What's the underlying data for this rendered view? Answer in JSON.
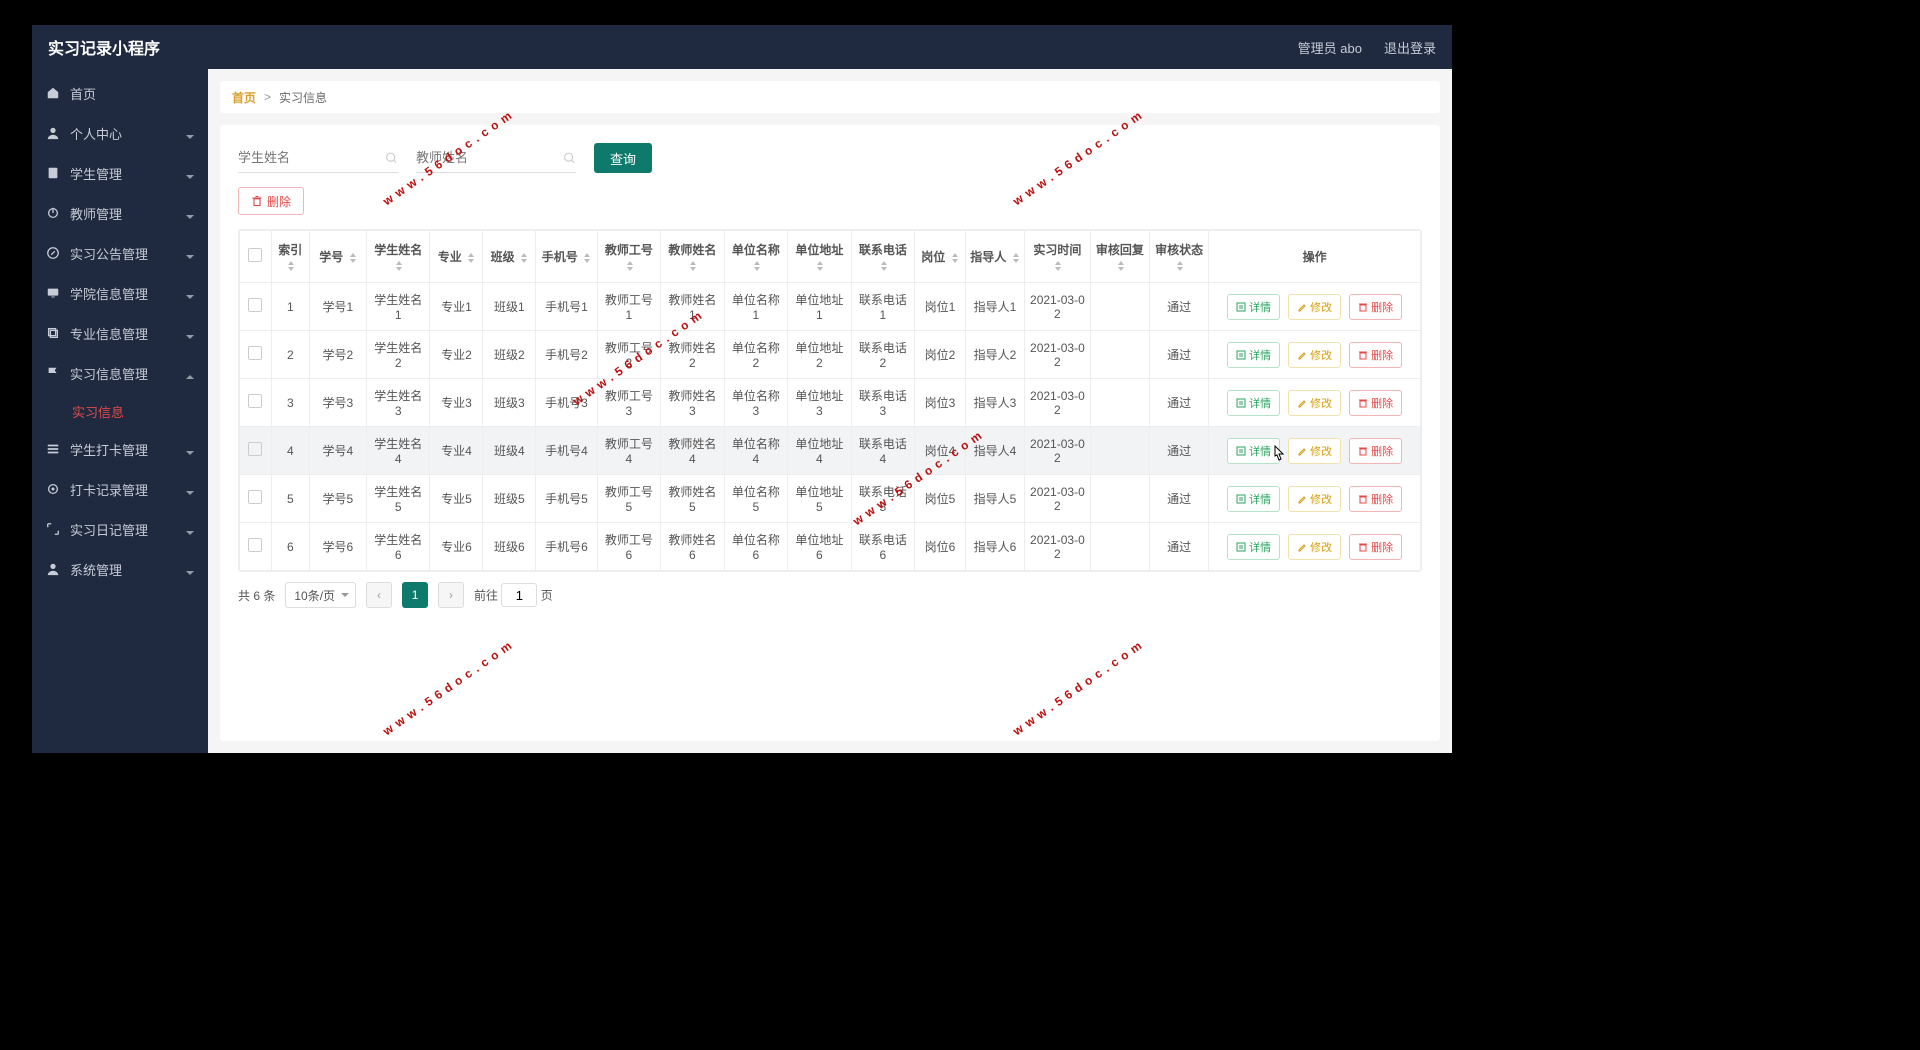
{
  "header": {
    "brand": "实习记录小程序",
    "user": "管理员 abo",
    "logout": "退出登录"
  },
  "sidebar": {
    "home": "首页",
    "profile": "个人中心",
    "student": "学生管理",
    "teacher": "教师管理",
    "notice": "实习公告管理",
    "college": "学院信息管理",
    "major": "专业信息管理",
    "intern_info": "实习信息管理",
    "intern_info_sub": "实习信息",
    "checkin": "学生打卡管理",
    "checkin_log": "打卡记录管理",
    "diary": "实习日记管理",
    "sys": "系统管理"
  },
  "breadcrumb": {
    "home": "首页",
    "current": "实习信息"
  },
  "filters": {
    "name_placeholder": "学生姓名",
    "teacher_placeholder": "教师姓名",
    "search": "查询",
    "delete": "删除"
  },
  "columns": {
    "c1": "索引",
    "c2": "学号",
    "c3": "学生姓名",
    "c4": "专业",
    "c5": "班级",
    "c6": "手机号",
    "c7": "教师工号",
    "c8": "教师姓名",
    "c9": "单位名称",
    "c10": "单位地址",
    "c11": "联系电话",
    "c12": "岗位",
    "c13": "指导人",
    "c14": "实习时间",
    "c15": "审核回复",
    "c16": "审核状态",
    "c17": "操作"
  },
  "ops": {
    "detail": "详情",
    "edit": "修改",
    "delete": "删除"
  },
  "rows": [
    {
      "idx": "1",
      "sno": "学号1",
      "name": "学生姓名1",
      "major": "专业1",
      "cls": "班级1",
      "phone": "手机号1",
      "tno": "教师工号1",
      "tname": "教师姓名1",
      "org": "单位名称1",
      "addr": "单位地址1",
      "tel": "联系电话1",
      "post": "岗位1",
      "mentor": "指导人1",
      "time": "2021-03-02",
      "reply": "",
      "status": "通过"
    },
    {
      "idx": "2",
      "sno": "学号2",
      "name": "学生姓名2",
      "major": "专业2",
      "cls": "班级2",
      "phone": "手机号2",
      "tno": "教师工号2",
      "tname": "教师姓名2",
      "org": "单位名称2",
      "addr": "单位地址2",
      "tel": "联系电话2",
      "post": "岗位2",
      "mentor": "指导人2",
      "time": "2021-03-02",
      "reply": "",
      "status": "通过"
    },
    {
      "idx": "3",
      "sno": "学号3",
      "name": "学生姓名3",
      "major": "专业3",
      "cls": "班级3",
      "phone": "手机号3",
      "tno": "教师工号3",
      "tname": "教师姓名3",
      "org": "单位名称3",
      "addr": "单位地址3",
      "tel": "联系电话3",
      "post": "岗位3",
      "mentor": "指导人3",
      "time": "2021-03-02",
      "reply": "",
      "status": "通过"
    },
    {
      "idx": "4",
      "sno": "学号4",
      "name": "学生姓名4",
      "major": "专业4",
      "cls": "班级4",
      "phone": "手机号4",
      "tno": "教师工号4",
      "tname": "教师姓名4",
      "org": "单位名称4",
      "addr": "单位地址4",
      "tel": "联系电话4",
      "post": "岗位4",
      "mentor": "指导人4",
      "time": "2021-03-02",
      "reply": "",
      "status": "通过"
    },
    {
      "idx": "5",
      "sno": "学号5",
      "name": "学生姓名5",
      "major": "专业5",
      "cls": "班级5",
      "phone": "手机号5",
      "tno": "教师工号5",
      "tname": "教师姓名5",
      "org": "单位名称5",
      "addr": "单位地址5",
      "tel": "联系电话5",
      "post": "岗位5",
      "mentor": "指导人5",
      "time": "2021-03-02",
      "reply": "",
      "status": "通过"
    },
    {
      "idx": "6",
      "sno": "学号6",
      "name": "学生姓名6",
      "major": "专业6",
      "cls": "班级6",
      "phone": "手机号6",
      "tno": "教师工号6",
      "tname": "教师姓名6",
      "org": "单位名称6",
      "addr": "单位地址6",
      "tel": "联系电话6",
      "post": "岗位6",
      "mentor": "指导人6",
      "time": "2021-03-02",
      "reply": "",
      "status": "通过"
    }
  ],
  "pager": {
    "total": "共 6 条",
    "pagesize": "10条/页",
    "current": "1",
    "goto_prefix": "前往",
    "goto_suffix": "页",
    "goto_value": "1"
  },
  "watermark": "www.56doc.com"
}
